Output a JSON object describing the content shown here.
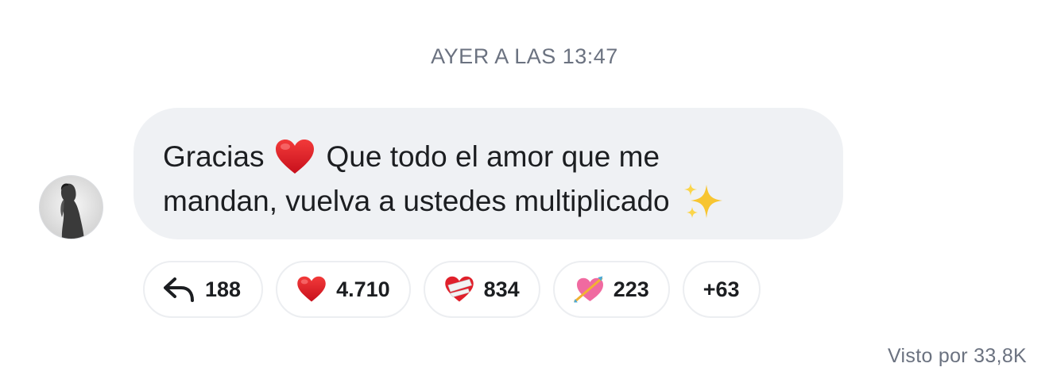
{
  "timestamp": "AYER A LAS 13:47",
  "message": {
    "line1_a": "Gracias",
    "line1_b": "Que todo el amor que me",
    "line2": "mandan, vuelva a ustedes multiplicado",
    "emoji_1": "red-heart",
    "emoji_2": "sparkles"
  },
  "reactions": {
    "reply": {
      "icon": "reply-arrow-icon",
      "count": "188"
    },
    "heart": {
      "icon": "red-heart",
      "count": "4.710"
    },
    "mending_heart": {
      "icon": "mending-heart",
      "count": "834"
    },
    "heart_arrow": {
      "icon": "heart-with-arrow",
      "count": "223"
    },
    "more": {
      "label": "+63"
    }
  },
  "seen_label": "Visto por 33,8K",
  "colors": {
    "bubble": "#eff1f4",
    "heart": "#e0202b",
    "muted_text": "#6b7280"
  }
}
